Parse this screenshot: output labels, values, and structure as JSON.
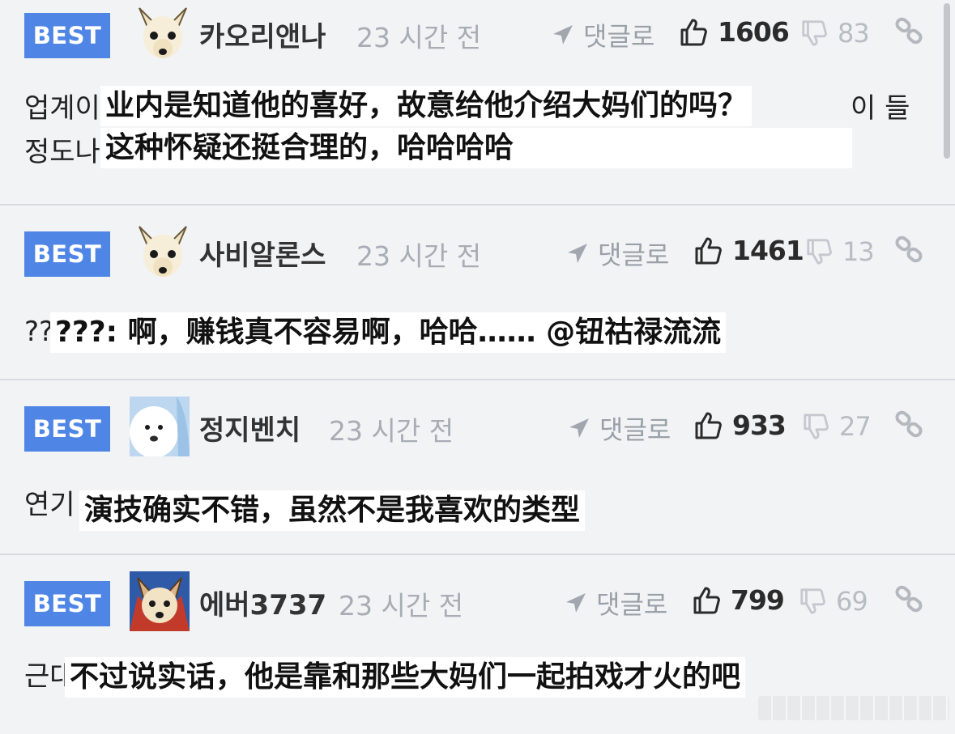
{
  "comments": [
    {
      "badge": "BEST",
      "username": "카오리앤나",
      "timestamp": "23 시간 전",
      "reply_label": "댓글로",
      "likes": "1606",
      "dislikes": "83",
      "body_lines": [
        "업계이",
        "정도나"
      ],
      "body_tail": "이 들",
      "subtitle_lines": [
        "业内是知道他的喜好，故意给他介绍大妈们的吗？",
        "这种怀疑还挺合理的，哈哈哈哈"
      ]
    },
    {
      "badge": "BEST",
      "username": "사비알론스",
      "timestamp": "23 시간 전",
      "reply_label": "댓글로",
      "likes": "1461",
      "dislikes": "13",
      "body_lines": [
        "??"
      ],
      "subtitle_lines": [
        "???: 啊，赚钱真不容易啊，哈哈……  @钮祜禄流流"
      ]
    },
    {
      "badge": "BEST",
      "username": "정지벤치",
      "timestamp": "23 시간 전",
      "reply_label": "댓글로",
      "likes": "933",
      "dislikes": "27",
      "body_lines": [
        "연기"
      ],
      "subtitle_lines": [
        "演技确实不错，虽然不是我喜欢的类型"
      ]
    },
    {
      "badge": "BEST",
      "username": "에버3737",
      "timestamp": "23 시간 전",
      "reply_label": "댓글로",
      "likes": "799",
      "dislikes": "69",
      "body_lines": [
        "근대"
      ],
      "subtitle_lines": [
        "不过说实话，他是靠和那些大妈们一起拍戏才火的吧"
      ]
    }
  ],
  "icons": {
    "reply": "reply-arrow-icon",
    "like": "thumbs-up-icon",
    "dislike": "thumbs-down-icon",
    "link": "link-icon"
  },
  "colors": {
    "badge": "#4f86e6",
    "background": "#f2f3f5",
    "muted": "#a8acb4"
  }
}
